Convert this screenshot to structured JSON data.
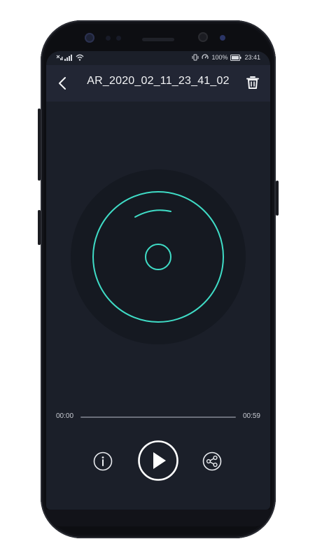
{
  "status_bar": {
    "battery_percent": "100%",
    "clock": "23:41",
    "network_icons": [
      "no-sim-icon",
      "signal-icon",
      "wifi-icon"
    ],
    "right_icons": [
      "vibrate-icon",
      "data-saver-icon",
      "battery-icon"
    ]
  },
  "header": {
    "title": "AR_2020_02_11_23_41_02",
    "back_icon": "chevron-left-icon",
    "delete_icon": "trash-icon"
  },
  "player": {
    "current_time": "00:00",
    "total_time": "00:59",
    "progress": 0.0,
    "disc_color": "#3fdcc6"
  },
  "controls": {
    "info_icon": "info-icon",
    "play_icon": "play-icon",
    "share_icon": "share-icon"
  },
  "colors": {
    "screen_bg": "#1b1f29",
    "appbar_bg": "#222634",
    "accent": "#3fdcc6",
    "text": "#f3f4f6"
  }
}
